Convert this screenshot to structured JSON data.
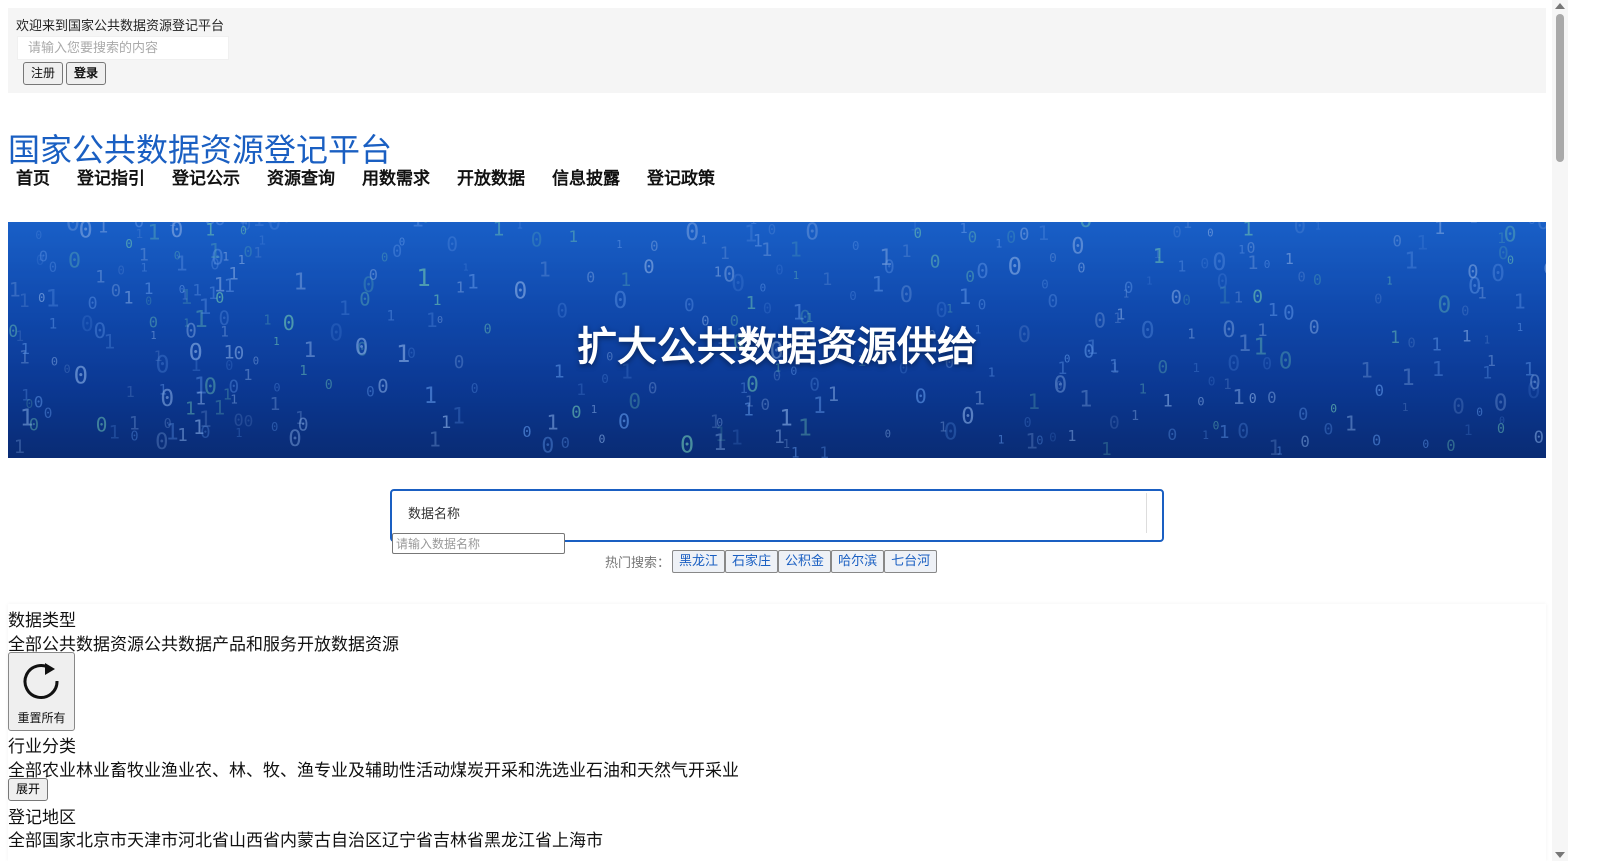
{
  "topbar": {
    "welcome": "欢迎来到国家公共数据资源登记平台",
    "search_placeholder": "请输入您要搜索的内容",
    "register_label": "注册",
    "login_label": "登录"
  },
  "header": {
    "logo": "国家公共数据资源登记平台",
    "nav": [
      "首页",
      "登记指引",
      "登记公示",
      "资源查询",
      "用数需求",
      "开放数据",
      "信息披露",
      "登记政策"
    ]
  },
  "banner": {
    "title": "扩大公共数据资源供给"
  },
  "search": {
    "category": "数据名称",
    "input_placeholder": "请输入数据名称",
    "hot_label": "热门搜索：",
    "hot_tags": [
      "黑龙江",
      "石家庄",
      "公积金",
      "哈尔滨",
      "七台河"
    ]
  },
  "filters": {
    "data_type_label": "数据类型",
    "data_type_options": "全部公共数据资源公共数据产品和服务开放数据资源",
    "reset_label": "重置所有",
    "industry_label": "行业分类",
    "industry_options": "全部农业林业畜牧业渔业农、林、牧、渔专业及辅助性活动煤炭开采和洗选业石油和天然气开采业",
    "expand_label": "展开",
    "region_label": "登记地区",
    "region_options": "全部国家北京市天津市河北省山西省内蒙古自治区辽宁省吉林省黑龙江省上海市"
  },
  "colors": {
    "brand_blue": "#1a5fc2",
    "topbar_bg": "#f5f5f5",
    "banner_blue": "#1355c2"
  }
}
